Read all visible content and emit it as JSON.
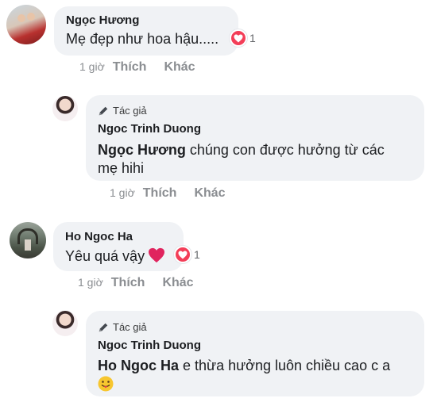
{
  "comments": [
    {
      "author": "Ngọc Hương",
      "text": "Mẹ đẹp như hoa hậu.....",
      "reaction_count": "1",
      "time": "1 giờ",
      "like_label": "Thích",
      "more_label": "Khác"
    },
    {
      "author_badge": "Tác giả",
      "author": "Ngoc Trinh Duong",
      "mention": "Ngọc Hương",
      "text_line1": " chúng con được hưởng từ các",
      "text_line2": "mẹ hihi",
      "time": "1 giờ",
      "like_label": "Thích",
      "more_label": "Khác"
    },
    {
      "author": "Ho Ngoc Ha",
      "text": "Yêu quá vậy",
      "reaction_count": "1",
      "time": "1 giờ",
      "like_label": "Thích",
      "more_label": "Khác"
    },
    {
      "author_badge": "Tác giả",
      "author": "Ngoc Trinh Duong",
      "mention": "Ho Ngoc Ha",
      "text_line1": " e thừa hưởng luôn chiều cao c a"
    }
  ],
  "colors": {
    "bubble": "#f0f2f5",
    "muted": "#8a8d91",
    "reaction": "#f33e58"
  },
  "icons": [
    "heart-icon",
    "pencil-icon",
    "grinning-tongue-emoji"
  ]
}
